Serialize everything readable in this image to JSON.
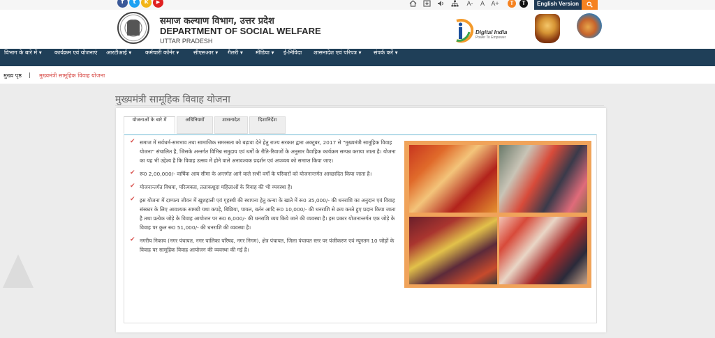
{
  "topbar": {
    "social": [
      {
        "icon": "facebook-icon",
        "glyph": "f",
        "color": "#3b5998"
      },
      {
        "icon": "twitter-icon",
        "glyph": "t",
        "color": "#1da1f2"
      },
      {
        "icon": "koo-icon",
        "glyph": "k",
        "color": "#f2b417"
      },
      {
        "icon": "youtube-icon",
        "glyph": "▶",
        "color": "#e02020"
      }
    ],
    "utility_icons": [
      "home-icon",
      "login-icon",
      "screen-reader-icon",
      "sitemap-icon"
    ],
    "font_small": "A-",
    "font_normal": "A",
    "font_large": "A+",
    "theme_light": "T",
    "theme_dark": "T",
    "language_button": "English Version",
    "search_icon": "search-icon"
  },
  "header": {
    "title_hindi": "समाज कल्याण विभाग, उत्तर प्रदेश",
    "title_english": "DEPARTMENT OF SOCIAL WELFARE",
    "subtitle": "UTTAR PRADESH",
    "digital_india": "Digital India",
    "digital_india_tagline": "Power To Empower"
  },
  "nav": {
    "items": [
      "विभाग के बारे में ▾",
      "कार्यक्रम एवं योजनाएं",
      "आरटीआई ▾",
      "कर्मचारी कॉर्नर ▾",
      "सीएसआर ▾",
      "गैलरी ▾",
      "मीडिया ▾",
      "ई-निविदा",
      "शासनादेश एवं परिपत्र ▾",
      "संपर्क करें ▾"
    ]
  },
  "breadcrumb": {
    "home": "मुख्य पृष्ठ",
    "separator": "|",
    "current": "मुख्यमंत्री सामूहिक विवाह योजना"
  },
  "page": {
    "title": "मुख्यमंत्री सामूहिक विवाह योजना",
    "tabs": [
      "योजनाओं के बारे में",
      "अधिनियमों",
      "शासनादेश",
      "दिशानिर्देश"
    ],
    "bullets": [
      "समाज में सर्वधर्म-समभाव तथा सामाजिक समरसता को बढ़ावा देने हेतु राज्य सरकार द्वारा अक्टूबर, 2017 से \"मुख्यमंत्री सामूहिक विवाह योजना\" संचालित है, जिसके अन्तर्गत विभिन्न समुदाय एवं धर्मों के रीति-रिवाजों के अनुसार वैवाहिक कार्यक्रम सम्पन्न कराया जाता है। योजना का यह भी उद्देश्य है कि विवाह उत्सव में होने वाले अनावश्यक प्रदर्शन एवं अपव्यय को समाप्त किया जाए।",
      "रू0 2,00,000/- वार्षिक आय सीमा के अन्तर्गत आने वाले सभी वर्गों के परिवारों को योजनान्तर्गत आच्छादित किया जाता है।",
      "योजनान्तर्गत विधवा, परित्यक्ता, तलाकशुदा महिलाओं के विवाह की भी व्यवस्था है।",
      "इस योजना में दाम्पत्य जीवन में खुशहाली एवं गृहस्थी की स्थापना हेतु कन्या के खाते में रू0 35,000/- की धनराशि का अनुदान एवं विवाह संस्कार के लिए आवश्यक सामग्री यथा कपड़े, बिछिया, पायल, बर्तन आदि रू0 10,000/- की धनराशि से क्रय करते हुए प्रदान किया जाता है तथा प्रत्येक जोड़े के विवाह आयोजन पर रू0 6,000/- की धनराशि व्यय किये जाने की व्यवस्था है। इस प्रकार योजनान्तर्गत एक जोड़े के विवाह पर कुल रू0 51,000/- की धनराशि की व्यवस्था है।",
      "नगरीय निकाय (नगर पंचायत, नगर पालिका परिषद, नगर निगम), क्षेत्र पंचायत, जिला पंचायत स्तर पर पंजीकरण एवं न्यूनतम 10 जोड़ों के विवाह पर सामूहिक विवाह आयोजन की व्यवस्था की गई है।"
    ],
    "bullet_icon": "check-icon"
  },
  "colors": {
    "nav_bg": "#1f3f58",
    "accent_orange": "#f58220",
    "breadcrumb_current": "#d9534f",
    "check_red": "#d9534f",
    "tab_underline": "#6db9d4"
  }
}
